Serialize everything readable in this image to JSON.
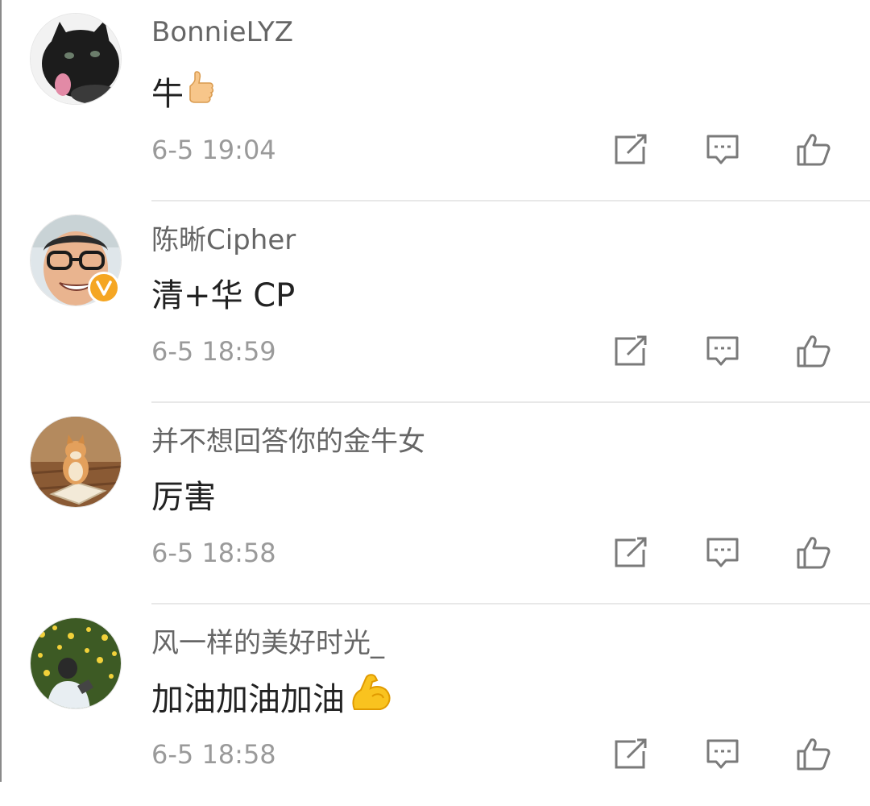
{
  "comments": [
    {
      "username": "BonnieLYZ",
      "text": "牛",
      "emoji": "thumbs-up-emoji",
      "time": "6-5 19:04",
      "avatar": "black-cat-avatar",
      "verified": false
    },
    {
      "username": "陈晰Cipher",
      "text": "清+华 CP",
      "emoji": null,
      "time": "6-5 18:59",
      "avatar": "man-glasses-avatar",
      "verified": true,
      "badge": "V"
    },
    {
      "username": "并不想回答你的金牛女",
      "text": "厉害",
      "emoji": null,
      "time": "6-5 18:58",
      "avatar": "shiba-dog-avatar",
      "verified": false
    },
    {
      "username": "风一样的美好时光_",
      "text": "加油加油加油",
      "emoji": "flexed-biceps-emoji",
      "time": "6-5 18:58",
      "avatar": "flower-field-avatar",
      "verified": false
    }
  ],
  "icons": {
    "repost": "repost-icon",
    "comment": "comment-icon",
    "like": "like-icon"
  },
  "colors": {
    "username": "#666666",
    "text": "#222222",
    "time": "#9a9a9a",
    "icon": "#7a7a7a",
    "verified_badge": "#f5a623",
    "divider": "#e8e8e8"
  }
}
